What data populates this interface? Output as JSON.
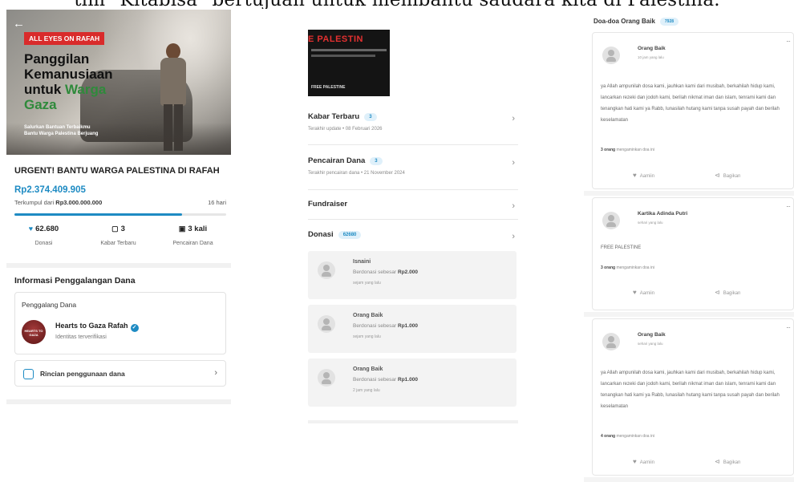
{
  "caption": "tim \"Kitabisa\" bertujuan untuk membantu saudara kita di Palestina.",
  "panel1": {
    "back_icon": "arrow-left-icon",
    "badge": "ALL EYES ON RAFAH",
    "hero_title_line1": "Panggilan",
    "hero_title_line2": "Kemanusiaan",
    "hero_title_line3a": "untuk ",
    "hero_title_line3b": "Warga",
    "hero_title_line4": "Gaza",
    "hero_sub_line1": "Salurkan Bantuan Terbaikmu",
    "hero_sub_line2": "Bantu Warga Palestina Berjuang",
    "title": "URGENT! BANTU WARGA PALESTINA DI RAFAH",
    "amount": "Rp2.374.409.905",
    "target_prefix": "Terkumpul dari ",
    "target_value": "Rp3.000.000.000",
    "days_left": "16 hari",
    "progress_fraction": 0.79,
    "stats": [
      {
        "icon": "heart-icon",
        "value": "62.680",
        "label": "Donasi"
      },
      {
        "icon": "document-icon",
        "value": "3",
        "label": "Kabar Terbaru"
      },
      {
        "icon": "wallet-icon",
        "value": "3 kali",
        "label": "Pencairan Dana"
      }
    ],
    "info_title": "Informasi Penggalangan Dana",
    "fundraiser_caption": "Penggalang Dana",
    "fundraiser_name": "Hearts to Gaza Rafah",
    "fundraiser_logo_text": "HEARTS TO GAZA",
    "fundraiser_sub": "Identitas terverifikasi",
    "rincian_label": "Rincian penggunaan dana",
    "accent": "#1e8bc3",
    "badge_color": "#d92b2b"
  },
  "panel2": {
    "thumb_title": "E PALESTIN",
    "thumb_footer": "FREE PALESTINE",
    "rows": [
      {
        "title": "Kabar Terbaru",
        "count": "3",
        "sub": "Terakhir update • 08 Februari 2026"
      },
      {
        "title": "Pencairan Dana",
        "count": "3",
        "sub": "Terakhir pencairan dana • 21 November 2024"
      },
      {
        "title": "Fundraiser",
        "count": "",
        "sub": ""
      },
      {
        "title": "Donasi",
        "count": "62680",
        "sub": ""
      }
    ],
    "donors": [
      {
        "name": "Isnaini",
        "amount_prefix": "Berdonasi sebesar ",
        "amount": "Rp2.000",
        "time": "sejam yang lalu"
      },
      {
        "name": "Orang Baik",
        "amount_prefix": "Berdonasi sebesar ",
        "amount": "Rp1.000",
        "time": "sejam yang lalu"
      },
      {
        "name": "Orang Baik",
        "amount_prefix": "Berdonasi sebesar ",
        "amount": "Rp1.000",
        "time": "2 jam yang lalu"
      }
    ]
  },
  "panel3": {
    "title": "Doa-doa Orang Baik",
    "count": "7928",
    "prayers": [
      {
        "name": "Orang Baik",
        "time": "10 jam yang lalu",
        "msg": "ya Allah ampunilah dosa kami, jauhkan kami dari musibah, berkahilah hidup kami, lancarkan rezeki dan jodoh kami, berilah nikmat iman dan islam, tenrami kami dan tenangkan hati kami ya Rabb, lunasilah hutang kami tanpa susah payah dan berilah keselamatan",
        "amin_bold": "3 orang",
        "amin_rest": " mengaminkan doa ini",
        "amin_label": "Aamiin",
        "share_label": "Bagikan"
      },
      {
        "name": "Kartika Adinda Putri",
        "time": "sehari yang lalu",
        "msg": "FREE PALESTINE",
        "amin_bold": "3 orang",
        "amin_rest": " mengaminkan doa ini",
        "amin_label": "Aamiin",
        "share_label": "Bagikan"
      },
      {
        "name": "Orang Baik",
        "time": "sehari yang lalu",
        "msg": "ya Allah ampunilah dosa kami, jauhkan kami dari musibah, berkahilah hidup kami, lancarkan rezeki dan jodoh kami, berilah nikmat iman dan islam, tenrami kami dan tenangkan hati kami ya Rabb, lunasilah hutang kami tanpa susah payah dan berilah keselamatan",
        "amin_bold": "4 orang",
        "amin_rest": " mengaminkan doa ini",
        "amin_label": "Aamiin",
        "share_label": "Bagikan"
      }
    ]
  }
}
